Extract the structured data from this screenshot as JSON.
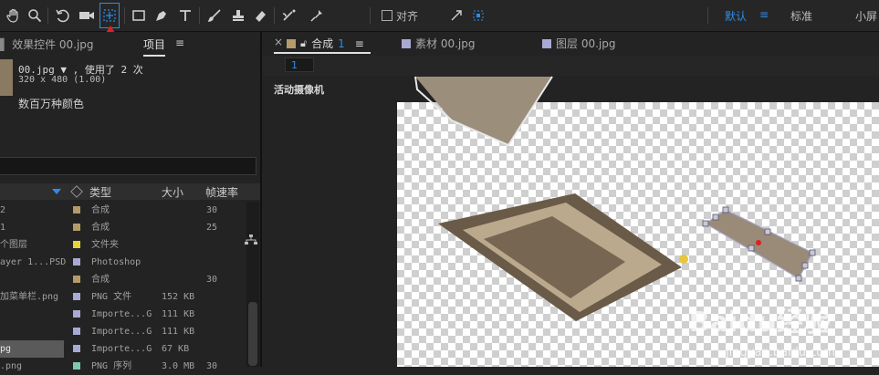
{
  "toolbar": {
    "align_checkbox_label": "对齐",
    "workspaces": [
      "默认",
      "标准",
      "小屏"
    ],
    "active_workspace": "默认",
    "tool_icons": [
      "hand-icon",
      "zoom-icon",
      "rotate-icon",
      "camera-icon",
      "pan-behind-icon",
      "rectangle-icon",
      "pen-icon",
      "type-icon",
      "brush-icon",
      "clone-stamp-icon",
      "eraser-icon",
      "roto-brush-icon",
      "puppet-pin-icon"
    ]
  },
  "left_panel": {
    "tabs": [
      "效果控件 00.jpg",
      "项目"
    ],
    "active_tab": "项目",
    "file_name": "00.jpg ▼ , 使用了 2 次",
    "file_dims": "320 x 480 (1.00)",
    "file_colors": "数百万种颜色",
    "columns": {
      "type": "类型",
      "size": "大小",
      "fps": "帧速率"
    },
    "rows": [
      {
        "name": "2",
        "color": "#b59a6a",
        "type": "合成",
        "size": "",
        "fps": "30"
      },
      {
        "name": "1",
        "color": "#b59a6a",
        "type": "合成",
        "size": "",
        "fps": "25"
      },
      {
        "name": "个图层",
        "color": "#e6d23a",
        "type": "文件夹",
        "size": "",
        "fps": ""
      },
      {
        "name": "ayer 1...PSD",
        "color": "#a9a9d6",
        "type": "Photoshop",
        "size": "",
        "fps": ""
      },
      {
        "name": "",
        "color": "#b59a6a",
        "type": "合成",
        "size": "",
        "fps": "30"
      },
      {
        "name": "加菜单栏.png",
        "color": "#a9a9d6",
        "type": "PNG 文件",
        "size": "152 KB",
        "fps": ""
      },
      {
        "name": "",
        "color": "#a9a9d6",
        "type": "Importe...G",
        "size": "111 KB",
        "fps": ""
      },
      {
        "name": "",
        "color": "#a9a9d6",
        "type": "Importe...G",
        "size": "111 KB",
        "fps": ""
      },
      {
        "name": "pg",
        "color": "#a9a9d6",
        "type": "Importe...G",
        "size": "67 KB",
        "fps": "",
        "selected": true
      },
      {
        "name": ".png",
        "color": "#7fc7b0",
        "type": "PNG 序列",
        "size": "3.0 MB",
        "fps": "30"
      }
    ]
  },
  "right_panel": {
    "tabs": [
      {
        "label": "合成",
        "suffix": "1",
        "color": "#b59a6a",
        "active": true
      },
      {
        "label": "素材 00.jpg",
        "color": "#a9a9d6",
        "active": false
      },
      {
        "label": "图层 00.jpg",
        "color": "#a9a9d6",
        "active": false
      }
    ],
    "comp_number": "1",
    "camera_label": "活动摄像机",
    "watermark": "Baidu经验",
    "watermark_sub": "jingyan.baidu.com"
  },
  "colors": {
    "accent": "#2d8ceb",
    "annotation_red": "#e02020",
    "panel_bg": "#232323"
  }
}
